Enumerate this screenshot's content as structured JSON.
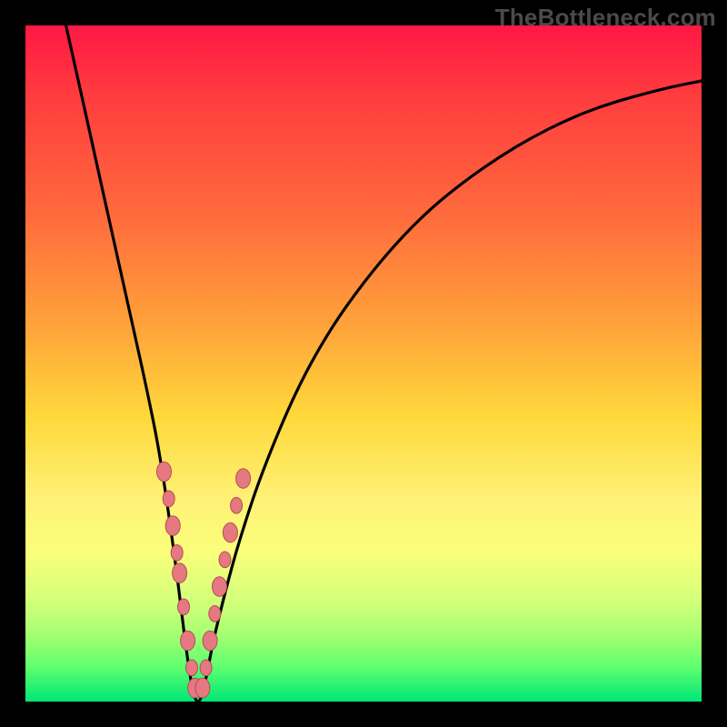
{
  "watermark": "TheBottleneck.com",
  "colors": {
    "frame": "#000000",
    "gradient_top": "#ff1744",
    "gradient_bottom": "#00e676",
    "curve": "#000000",
    "beads": "#e57880",
    "bead_stroke": "#b04f56"
  },
  "chart_data": {
    "type": "line",
    "title": "",
    "xlabel": "",
    "ylabel": "",
    "xlim": [
      0,
      100
    ],
    "ylim": [
      0,
      100
    ],
    "series": [
      {
        "name": "bottleneck-curve",
        "x": [
          6,
          8,
          10,
          12,
          14,
          16,
          18,
          20,
          22,
          23,
          24,
          25,
          26,
          27,
          28,
          30,
          32,
          35,
          40,
          45,
          50,
          55,
          60,
          65,
          70,
          75,
          80,
          85,
          90,
          95,
          100
        ],
        "y": [
          100,
          91,
          82,
          73,
          64,
          55,
          46,
          36,
          22,
          14,
          6,
          0,
          0,
          5,
          10,
          18,
          25,
          34,
          46,
          55,
          62,
          68,
          73,
          77,
          80.5,
          83.5,
          86,
          88,
          89.5,
          90.8,
          91.8
        ]
      }
    ],
    "beads": {
      "left_arm": [
        {
          "x": 20.5,
          "y": 34
        },
        {
          "x": 21.2,
          "y": 30
        },
        {
          "x": 21.8,
          "y": 26
        },
        {
          "x": 22.4,
          "y": 22
        },
        {
          "x": 22.8,
          "y": 19
        },
        {
          "x": 23.4,
          "y": 14
        },
        {
          "x": 24.0,
          "y": 9
        },
        {
          "x": 24.6,
          "y": 5
        },
        {
          "x": 25.1,
          "y": 2
        }
      ],
      "right_arm": [
        {
          "x": 26.2,
          "y": 2
        },
        {
          "x": 26.7,
          "y": 5
        },
        {
          "x": 27.3,
          "y": 9
        },
        {
          "x": 28.0,
          "y": 13
        },
        {
          "x": 28.7,
          "y": 17
        },
        {
          "x": 29.5,
          "y": 21
        },
        {
          "x": 30.3,
          "y": 25
        },
        {
          "x": 31.2,
          "y": 29
        },
        {
          "x": 32.2,
          "y": 33
        }
      ]
    }
  }
}
